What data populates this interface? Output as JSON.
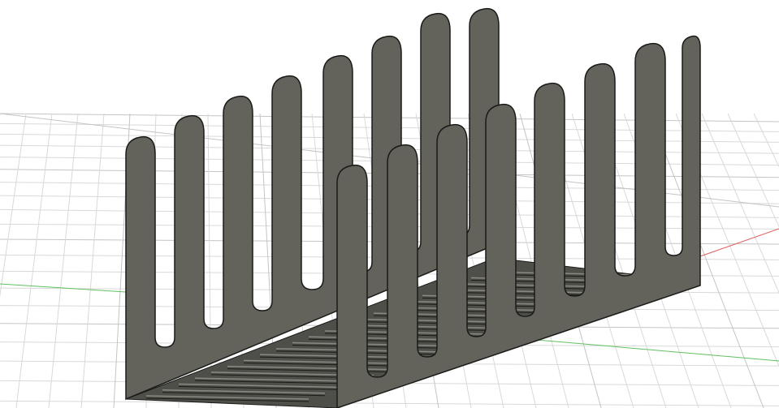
{
  "viewport": {
    "model": "dish-rack",
    "colors": {
      "background": "#ffffff",
      "grid": "#d9d9d9",
      "grid_major": "#c4c4c4",
      "model_face": "#63635c",
      "model_edge": "#1a1a18",
      "model_highlight": "#8a8a82",
      "floor": "#4f4f4a",
      "x_axis": "#e06060",
      "y_axis": "#60c060"
    }
  }
}
